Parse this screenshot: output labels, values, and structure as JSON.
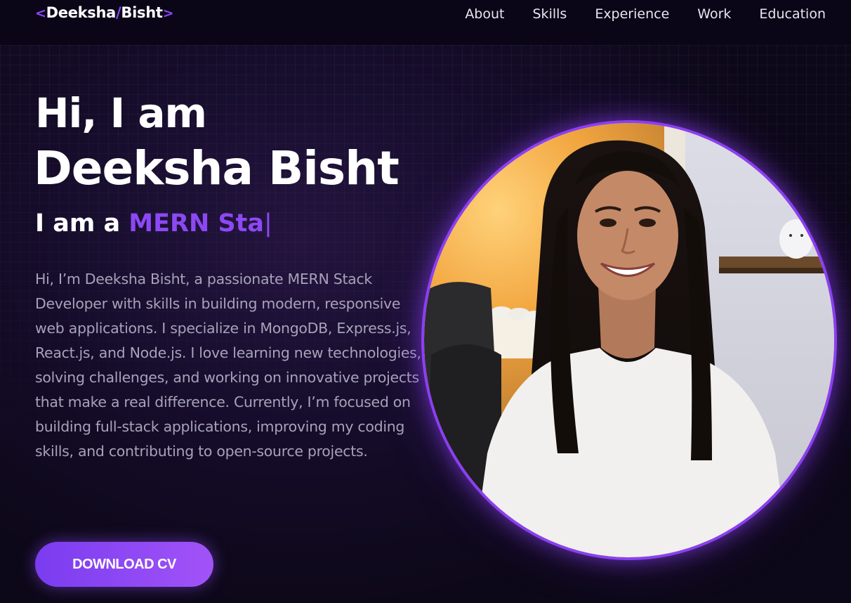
{
  "nav": {
    "logo": {
      "open_bracket": "<",
      "first": "Deeksha",
      "slash": "/",
      "last": "Bisht",
      "close_bracket": ">"
    },
    "links": [
      "About",
      "Skills",
      "Experience",
      "Work",
      "Education"
    ]
  },
  "hero": {
    "greeting": "Hi, I am",
    "name": "Deeksha Bisht",
    "role_prefix": "I am a ",
    "role_typed": "MERN Sta",
    "cursor": "|",
    "bio": "Hi, I’m Deeksha Bisht, a passionate MERN Stack Developer with skills in building modern, responsive web applications. I specialize in MongoDB, Express.js, React.js, and Node.js. I love learning new technologies, solving challenges, and working on innovative projects that make a real difference. Currently, I’m focused on building full-stack applications, improving my coding skills, and contributing to open-source projects.",
    "cta_label": "DOWNLOAD CV"
  },
  "colors": {
    "accent": "#8b45f5",
    "background": "#0c0818",
    "text_primary": "#ffffff",
    "text_muted": "#a7a2b9"
  }
}
